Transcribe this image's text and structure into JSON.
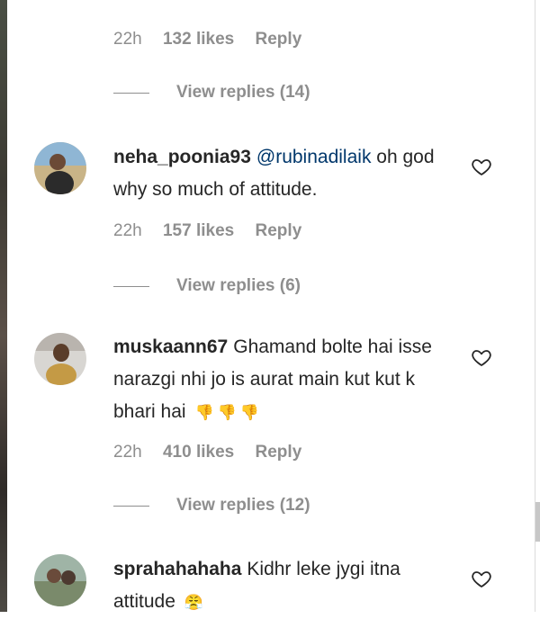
{
  "comments": [
    {
      "meta": {
        "time": "22h",
        "likes": "132 likes",
        "reply": "Reply"
      },
      "view_replies": "View replies (14)"
    },
    {
      "username": "neha_poonia93",
      "mention": "@rubinadilaik",
      "text": " oh god why so much of attitude.",
      "meta": {
        "time": "22h",
        "likes": "157 likes",
        "reply": "Reply"
      },
      "view_replies": "View replies (6)"
    },
    {
      "username": "muskaann67",
      "text": "Ghamand bolte hai isse narazgi nhi jo is aurat main kut kut k bhari hai",
      "emoji": "👎👎👎",
      "meta": {
        "time": "22h",
        "likes": "410 likes",
        "reply": "Reply"
      },
      "view_replies": "View replies (12)"
    },
    {
      "username": "sprahahahaha",
      "text": "Kidhr leke jygi itna attitude",
      "emoji": "😤"
    }
  ],
  "icons": {
    "like": "heart-outline-icon"
  }
}
